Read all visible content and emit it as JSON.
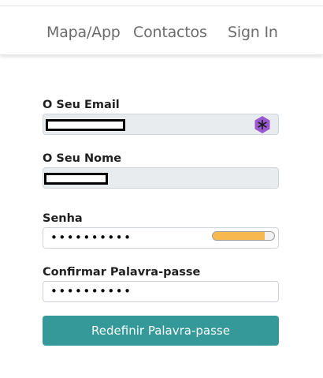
{
  "nav": {
    "items": [
      {
        "label": "Mapa/App"
      },
      {
        "label": "Contactos"
      },
      {
        "label": "Sign In"
      }
    ]
  },
  "form": {
    "email": {
      "label": "O Seu Email",
      "value": ""
    },
    "name": {
      "label": "O Seu Nome",
      "value": ""
    },
    "password": {
      "label": "Senha",
      "value": "••••••••••",
      "strength_fraction": 0.85,
      "strength_color": "#f6b84f"
    },
    "confirm": {
      "label": "Confirmar Palavra-passe",
      "value": "••••••••••"
    },
    "submit_label": "Redefinir Palavra-passe"
  },
  "icons": {
    "email_field_icon": "password-manager-extension-icon"
  },
  "colors": {
    "primary_button": "#35999a",
    "disabled_field": "#e9ecef",
    "extension_icon": "#9b59d0"
  }
}
